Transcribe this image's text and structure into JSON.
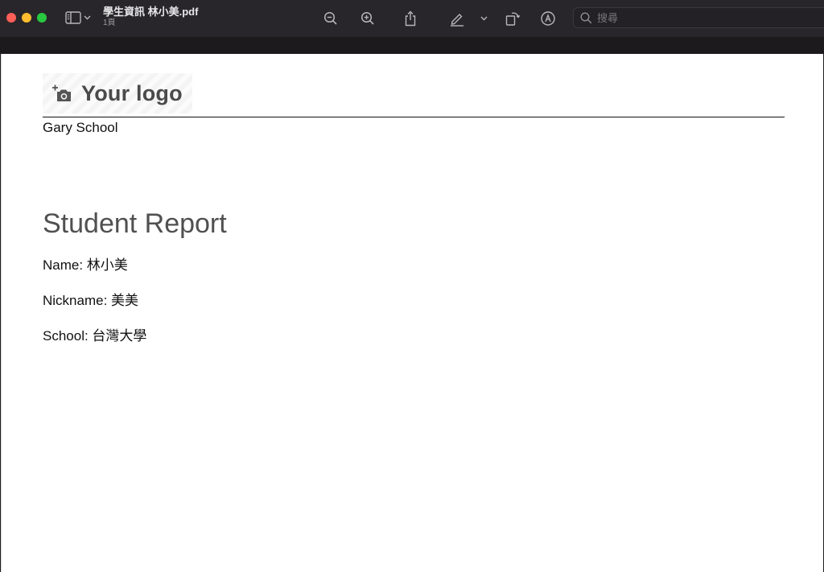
{
  "window": {
    "title": "學生資訊 林小美.pdf",
    "subtitle": "1頁"
  },
  "toolbar": {
    "icons": [
      "sidebar-icon",
      "chevron-down-icon",
      "zoom-out-icon",
      "zoom-in-icon",
      "share-icon",
      "highlight-icon",
      "chevron-down-icon",
      "rotate-icon",
      "markup-icon",
      "search-icon"
    ],
    "search_placeholder": "搜尋"
  },
  "document": {
    "logo_text": "Your logo",
    "school_header": "Gary School",
    "report_title": "Student Report",
    "fields": [
      {
        "text": "Name: 林小美"
      },
      {
        "text": "Nickname: 美美"
      },
      {
        "text": "School: 台灣大學"
      }
    ]
  },
  "colors": {
    "close": "#ff5f57",
    "minimize": "#febc2e",
    "maximize": "#28c840",
    "toolbar_bg": "#28262a",
    "page_bg": "#ffffff"
  }
}
